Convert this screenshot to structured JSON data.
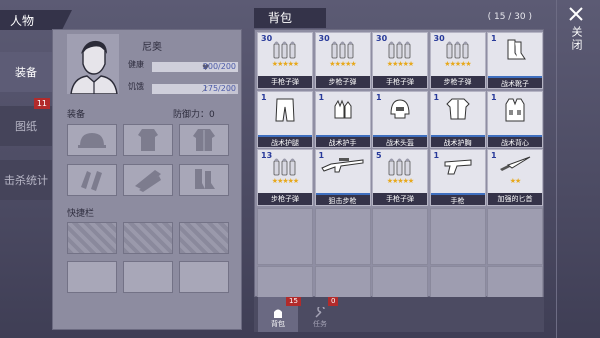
{
  "character_header": "人物",
  "bag_header": "背包",
  "bag_capacity": "( 15 / 30 )",
  "close_label": "关闭",
  "nav": [
    {
      "label": "装备",
      "badge": ""
    },
    {
      "label": "图纸",
      "badge": "11"
    },
    {
      "label": "击杀统计",
      "badge": ""
    }
  ],
  "character": {
    "name": "尼奥",
    "health_label": "健康",
    "health_value": "200/200",
    "hunger_label": "饥饿",
    "hunger_value": "175/200",
    "health_fraction": 1.0,
    "hunger_fraction": 0.875,
    "equipment_label": "装备",
    "defense_label": "防御力：0",
    "quickbar_label": "快捷栏"
  },
  "equip_slots": [
    "hat-icon",
    "shirt-icon",
    "jacket-icon",
    "gloves-icon",
    "pants-icon",
    "boots-icon"
  ],
  "items": [
    {
      "count": "30",
      "name": "手枪子弹",
      "stars": "★★★★★",
      "icon": "bullets-icon"
    },
    {
      "count": "30",
      "name": "步枪子弹",
      "stars": "★★★★★",
      "icon": "bullets-icon"
    },
    {
      "count": "30",
      "name": "手枪子弹",
      "stars": "★★★★★",
      "icon": "bullets-icon"
    },
    {
      "count": "30",
      "name": "步枪子弹",
      "stars": "★★★★★",
      "icon": "bullets-icon"
    },
    {
      "count": "1",
      "name": "战术靴子",
      "stars": "",
      "icon": "boots-icon"
    },
    {
      "count": "1",
      "name": "战术护腿",
      "stars": "",
      "icon": "pants-icon"
    },
    {
      "count": "1",
      "name": "战术护手",
      "stars": "",
      "icon": "gloves-icon"
    },
    {
      "count": "1",
      "name": "战术头盔",
      "stars": "",
      "icon": "helmet-icon"
    },
    {
      "count": "1",
      "name": "战术护胸",
      "stars": "",
      "icon": "chest-icon"
    },
    {
      "count": "1",
      "name": "战术背心",
      "stars": "",
      "icon": "vest-icon"
    },
    {
      "count": "13",
      "name": "步枪子弹",
      "stars": "★★★★★",
      "icon": "bullets-icon"
    },
    {
      "count": "1",
      "name": "狙击步枪",
      "stars": "",
      "icon": "rifle-icon"
    },
    {
      "count": "5",
      "name": "手枪子弹",
      "stars": "★★★★★",
      "icon": "bullets-icon"
    },
    {
      "count": "1",
      "name": "手枪",
      "stars": "",
      "icon": "pistol-icon"
    },
    {
      "count": "1",
      "name": "加强的匕首",
      "stars": "★★",
      "icon": "knife-icon"
    }
  ],
  "bottom_tabs": [
    {
      "label": "背包",
      "badge": "15"
    },
    {
      "label": "任务",
      "badge": "0"
    }
  ]
}
